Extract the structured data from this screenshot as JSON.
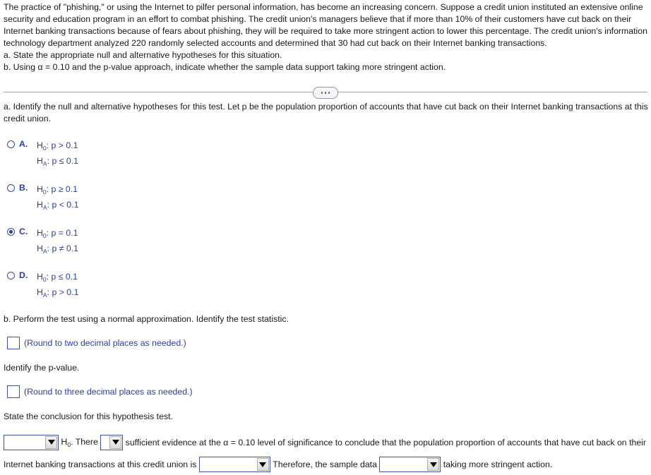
{
  "problem": {
    "paragraph": "The practice of \"phishing,\" or using the Internet to pilfer personal information, has become an increasing concern. Suppose a credit union instituted an extensive online security and education program in an effort to combat phishing. The credit union's managers believe that if more than 10% of their customers have cut back on their Internet banking transactions because of fears about phishing, they will be required to take more stringent action to lower this percentage. The credit union's information technology department analyzed 220 randomly selected accounts and determined that 30 had cut back on their Internet banking transactions.",
    "part_a": "a. State the appropriate null and alternative hypotheses for this situation.",
    "part_b": "b. Using α = 0.10 and the p-value approach, indicate whether the sample data support taking more stringent action."
  },
  "divider": {
    "name": "expand-collapse-pill"
  },
  "question_a": {
    "prompt": "a. Identify the null and alternative hypotheses for this test. Let p be the population proportion of accounts that have cut back on their Internet banking transactions at this credit union.",
    "choices": [
      {
        "letter": "A.",
        "null": "H",
        "null_sub": "0",
        "null_rest": ": p > 0.1",
        "alt": "H",
        "alt_sub": "A",
        "alt_rest": ": p ≤ 0.1",
        "selected": false
      },
      {
        "letter": "B.",
        "null": "H",
        "null_sub": "0",
        "null_rest": ": p ≥ 0.1",
        "alt": "H",
        "alt_sub": "A",
        "alt_rest": ": p < 0.1",
        "selected": false
      },
      {
        "letter": "C.",
        "null": "H",
        "null_sub": "0",
        "null_rest": ": p = 0.1",
        "alt": "H",
        "alt_sub": "A",
        "alt_rest": ": p ≠ 0.1",
        "selected": true
      },
      {
        "letter": "D.",
        "null": "H",
        "null_sub": "0",
        "null_rest": ": p ≤ 0.1",
        "alt": "H",
        "alt_sub": "A",
        "alt_rest": ": p > 0.1",
        "selected": false
      }
    ]
  },
  "question_b": {
    "prompt": "b. Perform the test using a normal approximation. Identify the test statistic.",
    "test_statistic_value": "",
    "test_statistic_hint": "(Round to two decimal places as needed.)",
    "pvalue_prompt": "Identify the p-value.",
    "pvalue_value": "",
    "pvalue_hint": "(Round to three decimal places as needed.)"
  },
  "conclusion": {
    "prompt": "State the conclusion for this hypothesis test.",
    "dropdown1_value": "",
    "text1_h": "H",
    "text1_sub": "0",
    "text1_rest": ". There",
    "dropdown2_value": "",
    "text2": "sufficient evidence at the α = 0.10 level of significance to conclude that the population proportion of accounts that have cut back on their Internet banking transactions at this credit union is",
    "dropdown3_value": "",
    "text3": "Therefore, the sample data",
    "dropdown4_value": "",
    "text4": "taking more stringent action."
  },
  "colors": {
    "body_text": "#181818",
    "accent_blue": "#2c3ea0",
    "field_border": "#3b54a8",
    "divider": "#9aa5b1"
  }
}
